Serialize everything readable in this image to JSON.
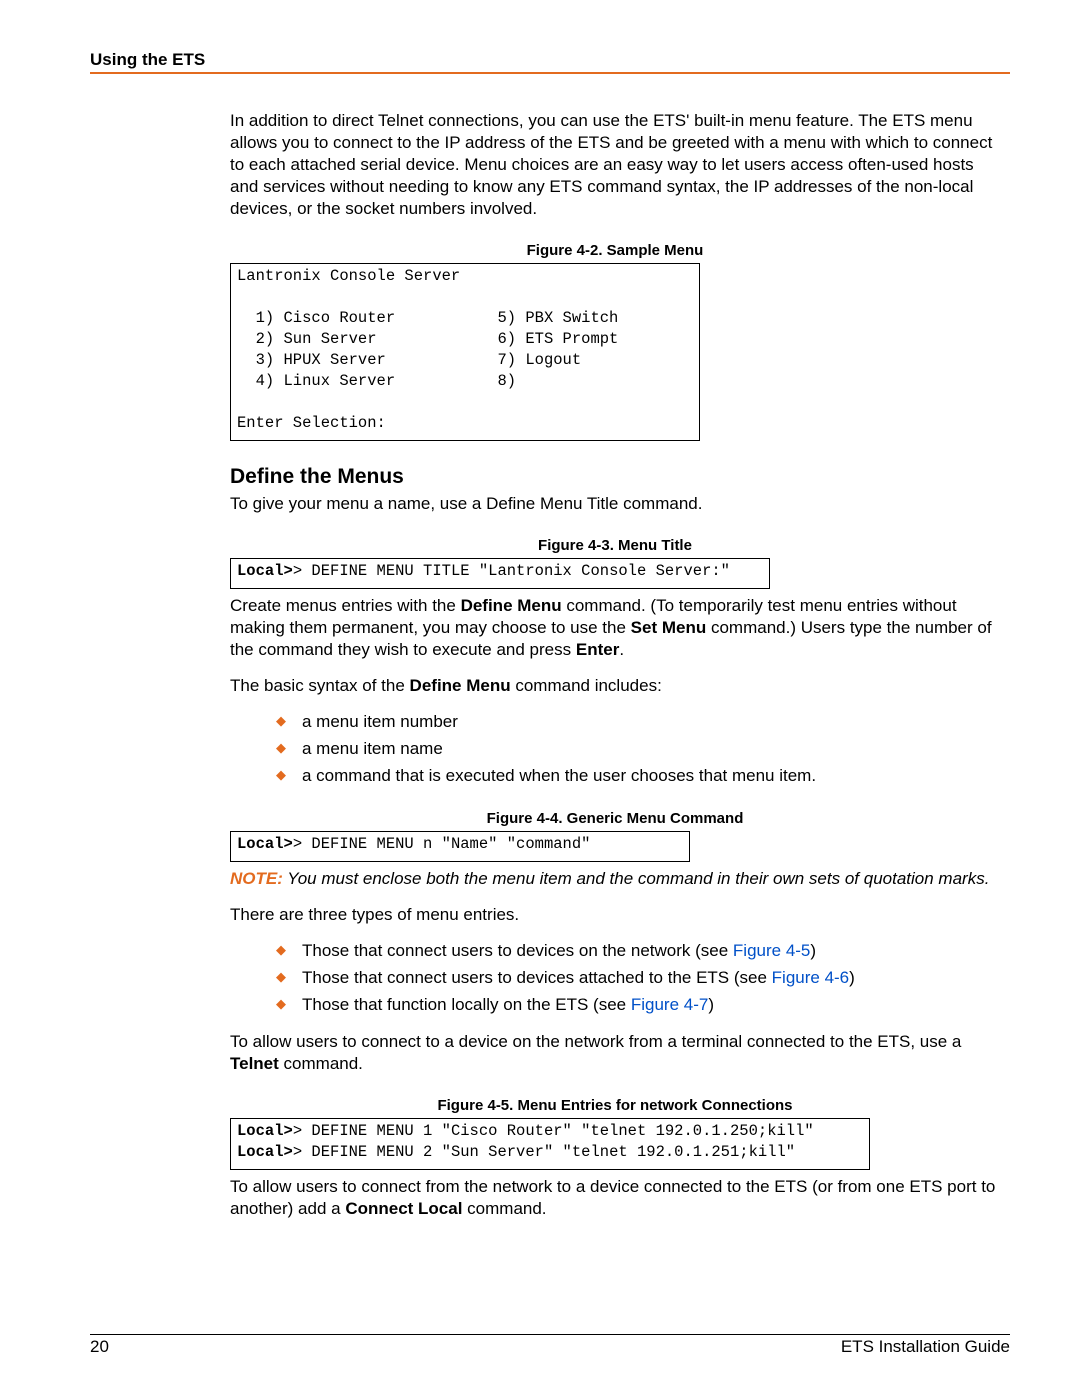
{
  "header": {
    "title": "Using the ETS"
  },
  "para1": "In addition to direct Telnet connections, you can use the ETS' built-in menu feature. The ETS menu allows you to connect to the IP address of the ETS and be greeted with a menu with which to connect to each attached serial device. Menu choices are an easy way to let users access often-used hosts and services without needing to know any ETS command syntax, the IP addresses of the non-local devices, or the socket numbers involved.",
  "fig42": {
    "cap": "Figure 4-2. Sample Menu",
    "lines": [
      "Lantronix Console Server",
      "",
      "  1) Cisco Router           5) PBX Switch",
      "  2) Sun Server             6) ETS Prompt",
      "  3) HPUX Server            7) Logout",
      "  4) Linux Server           8)",
      "",
      "Enter Selection:"
    ]
  },
  "h2": "Define the Menus",
  "para2": "To give your menu a name, use a Define Menu Title command.",
  "fig43": {
    "cap": "Figure 4-3. Menu Title",
    "prefix": "Local>",
    "rest": "> DEFINE MENU TITLE \"Lantronix Console Server:\""
  },
  "para3_plain": "Create menus entries with the ",
  "para3_bold1": "Define Menu",
  "para3_mid": " command.  (To temporarily test menu entries without making them permanent, you may choose to use the ",
  "para3_bold2": "Set Menu",
  "para3_mid2": " command.)  Users type the number of the command they wish to execute and press ",
  "para3_bold3": "Enter",
  "para3_end": ".",
  "para4_pre": "The basic syntax of the ",
  "para4_bold": "Define Menu",
  "para4_post": " command includes:",
  "list1": [
    "a menu item number",
    "a menu item name",
    "a command that is executed when the user chooses that menu item."
  ],
  "fig44": {
    "cap": "Figure 4-4. Generic Menu Command",
    "prefix": "Local>",
    "rest": "> DEFINE MENU n \"Name\" \"command\""
  },
  "note_lead": "NOTE:",
  "note_body": " You must enclose both the menu item and the command in their own sets of quotation marks.",
  "para5": "There are three types of menu entries.",
  "list2": [
    {
      "text": "Those that connect users to devices on the network (see ",
      "link": "Figure 4-5",
      "tail": ")"
    },
    {
      "text": "Those that connect users to devices attached to the ETS (see ",
      "link": "Figure 4-6",
      "tail": ")"
    },
    {
      "text": "Those that function locally on the ETS (see ",
      "link": "Figure 4-7",
      "tail": ")"
    }
  ],
  "para6_pre": "To allow users to connect to a device on the network from a terminal connected to the ETS, use a ",
  "para6_bold": "Telnet",
  "para6_post": " command.",
  "fig45": {
    "cap": "Figure 4-5. Menu Entries for network Connections",
    "l1p": "Local>",
    "l1r": "> DEFINE MENU 1 \"Cisco Router\" \"telnet 192.0.1.250;kill\"",
    "l2p": "Local>",
    "l2r": "> DEFINE MENU 2 \"Sun Server\" \"telnet 192.0.1.251;kill\""
  },
  "para7_pre": "To allow users to connect from the network to a device connected to the ETS (or from one ETS port to another) add a ",
  "para7_bold": "Connect Local",
  "para7_post": " command.",
  "footer": {
    "page": "20",
    "doc": "ETS Installation Guide"
  }
}
